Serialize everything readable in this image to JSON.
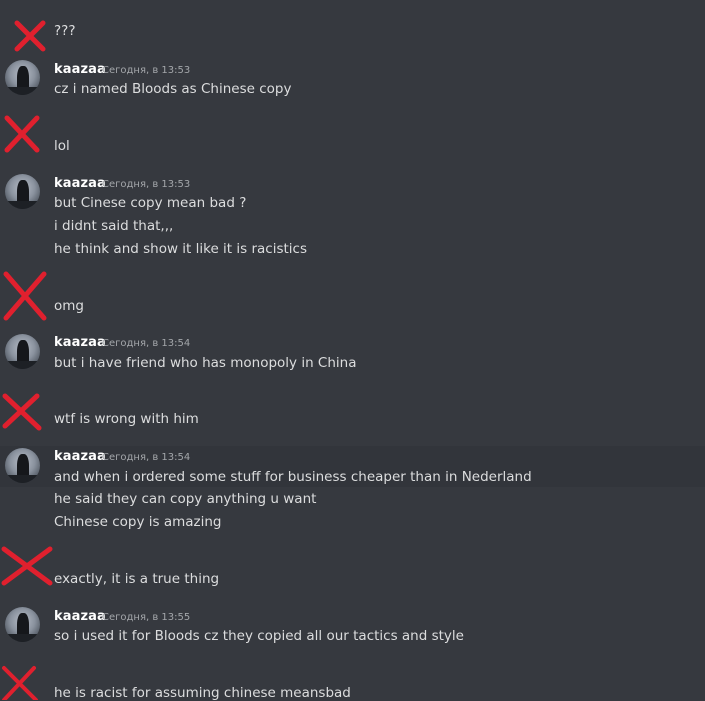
{
  "messages": [
    {
      "kind": "redacted",
      "lines": [
        "???"
      ]
    },
    {
      "kind": "user",
      "author": "kaazaa",
      "time": "Сегодня, в 13:53",
      "lines": [
        "cz i named Bloods as Chinese copy"
      ]
    },
    {
      "kind": "redacted",
      "lines": [
        "lol"
      ]
    },
    {
      "kind": "user",
      "author": "kaazaa",
      "time": "Сегодня, в 13:53",
      "lines": [
        "but Cinese copy mean bad ?",
        "i didnt said that,,,",
        "he think and show it like it is racistics"
      ]
    },
    {
      "kind": "redacted",
      "lines": [
        "omg"
      ]
    },
    {
      "kind": "user",
      "author": "kaazaa",
      "time": "Сегодня, в 13:54",
      "lines": [
        "but i have friend who has monopoly in China"
      ]
    },
    {
      "kind": "redacted",
      "lines": [
        "wtf is wrong with him"
      ]
    },
    {
      "kind": "user",
      "author": "kaazaa",
      "time": "Сегодня, в 13:54",
      "lines": [
        "and when i ordered some stuff for business cheaper than in Nederland",
        "he said they can copy anything u want",
        "Chinese copy is amazing"
      ]
    },
    {
      "kind": "redacted",
      "lines": [
        "exactly, it is a true thing"
      ]
    },
    {
      "kind": "user",
      "author": "kaazaa",
      "time": "Сегодня, в 13:55",
      "lines": [
        "so i used it for Bloods cz they copied all our tactics and style"
      ]
    },
    {
      "kind": "redacted",
      "lines": [
        "he is racist for assuming chinese meansbad"
      ]
    }
  ],
  "colors": {
    "background": "#36393f",
    "text": "#dcddde",
    "author": "#ffffff",
    "timestamp": "#a3a6aa",
    "redaction": "#e0202e"
  }
}
